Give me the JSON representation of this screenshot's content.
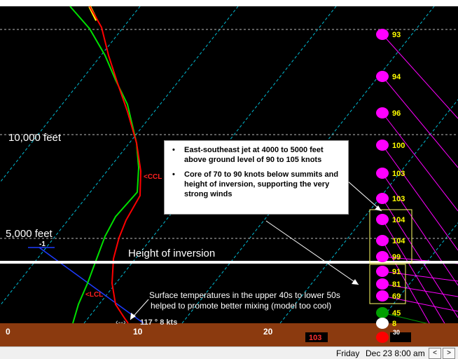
{
  "plot": {
    "background": "#000000",
    "ground_color": "#8b3a0f",
    "env_temp_color": "#ff0000",
    "dewpoint_color": "#00e000",
    "isotherm_color": "#00bcd4",
    "wind_marker_color": "#ff00ff",
    "altitude_labels": [
      "10,000 feet",
      "5,000 feet"
    ],
    "inversion_label": "Height of inversion",
    "x_ticks": [
      "0",
      "10",
      "20"
    ],
    "ccl_label": "<CCL",
    "lcl_label": "<LCL",
    "lifted_index": "-1",
    "surface_wind": "117 ° 8 kts",
    "surface_note_line1": "Surface temperatures in the upper 40s to lower 50s",
    "surface_note_line2": "helped to promote better mixing (model too cool)",
    "ground_readout": "103",
    "wind_speeds": [
      {
        "speed": "93",
        "color": "#ff00ff"
      },
      {
        "speed": "94",
        "color": "#ff00ff"
      },
      {
        "speed": "96",
        "color": "#ff00ff"
      },
      {
        "speed": "100",
        "color": "#ff00ff"
      },
      {
        "speed": "103",
        "color": "#ff00ff"
      },
      {
        "speed": "103",
        "color": "#ff00ff"
      },
      {
        "speed": "104",
        "color": "#ff00ff"
      },
      {
        "speed": "104",
        "color": "#ff00ff"
      },
      {
        "speed": "99",
        "color": "#ff00ff"
      },
      {
        "speed": "91",
        "color": "#ff00ff"
      },
      {
        "speed": "81",
        "color": "#ff00ff"
      },
      {
        "speed": "69",
        "color": "#ff00ff"
      },
      {
        "speed": "45",
        "color": "#00a000"
      },
      {
        "speed": "8",
        "color": "#ffffff"
      },
      {
        "speed": "18",
        "color": "#ff0000"
      }
    ],
    "ground_sub_label": "30"
  },
  "callout": {
    "bullet1": "East-southeast jet at 4000 to 5000 feet above ground level of 90 to 105 knots",
    "bullet2": "Core of 70 to 90 knots below summits and height of inversion, supporting the very strong winds"
  },
  "status_bar": {
    "day": "Friday",
    "datetime": "Dec 23  8:00 am",
    "prev_label": "<",
    "next_label": ">"
  }
}
